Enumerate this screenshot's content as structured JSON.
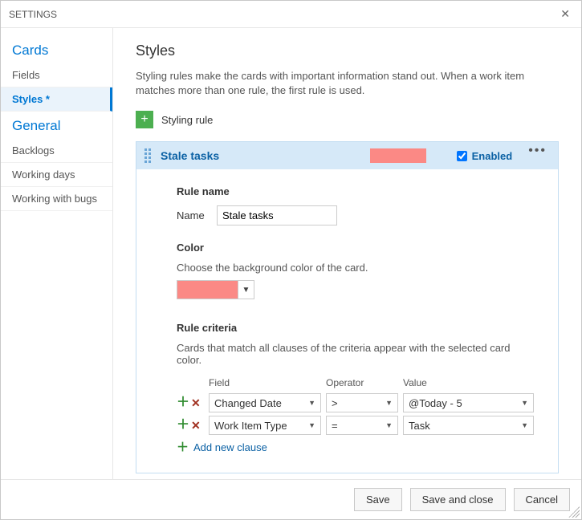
{
  "window": {
    "title": "SETTINGS"
  },
  "sidebar": {
    "sections": [
      {
        "title": "Cards",
        "items": [
          {
            "label": "Fields",
            "selected": false
          },
          {
            "label": "Styles *",
            "selected": true
          }
        ]
      },
      {
        "title": "General",
        "items": [
          {
            "label": "Backlogs",
            "selected": false
          },
          {
            "label": "Working days",
            "selected": false
          },
          {
            "label": "Working with bugs",
            "selected": false
          }
        ]
      }
    ]
  },
  "main": {
    "title": "Styles",
    "description": "Styling rules make the cards with important information stand out. When a work item matches more than one rule, the first rule is used.",
    "add_rule_label": "Styling rule"
  },
  "rule": {
    "title": "Stale tasks",
    "swatch_color": "#fb8985",
    "enabled_label": "Enabled",
    "enabled": true,
    "section_rule_name": "Rule name",
    "name_label": "Name",
    "name_value": "Stale tasks",
    "section_color": "Color",
    "color_description": "Choose the background color of the card.",
    "color_value": "#fb8985",
    "section_criteria": "Rule criteria",
    "criteria_description": "Cards that match all clauses of the criteria appear with the selected card color.",
    "criteria_headers": {
      "field": "Field",
      "operator": "Operator",
      "value": "Value"
    },
    "clauses": [
      {
        "field": "Changed Date",
        "operator": ">",
        "value": "@Today - 5"
      },
      {
        "field": "Work Item Type",
        "operator": "=",
        "value": "Task"
      }
    ],
    "add_clause_label": "Add new clause"
  },
  "footer": {
    "save": "Save",
    "save_and_close": "Save and close",
    "cancel": "Cancel"
  }
}
